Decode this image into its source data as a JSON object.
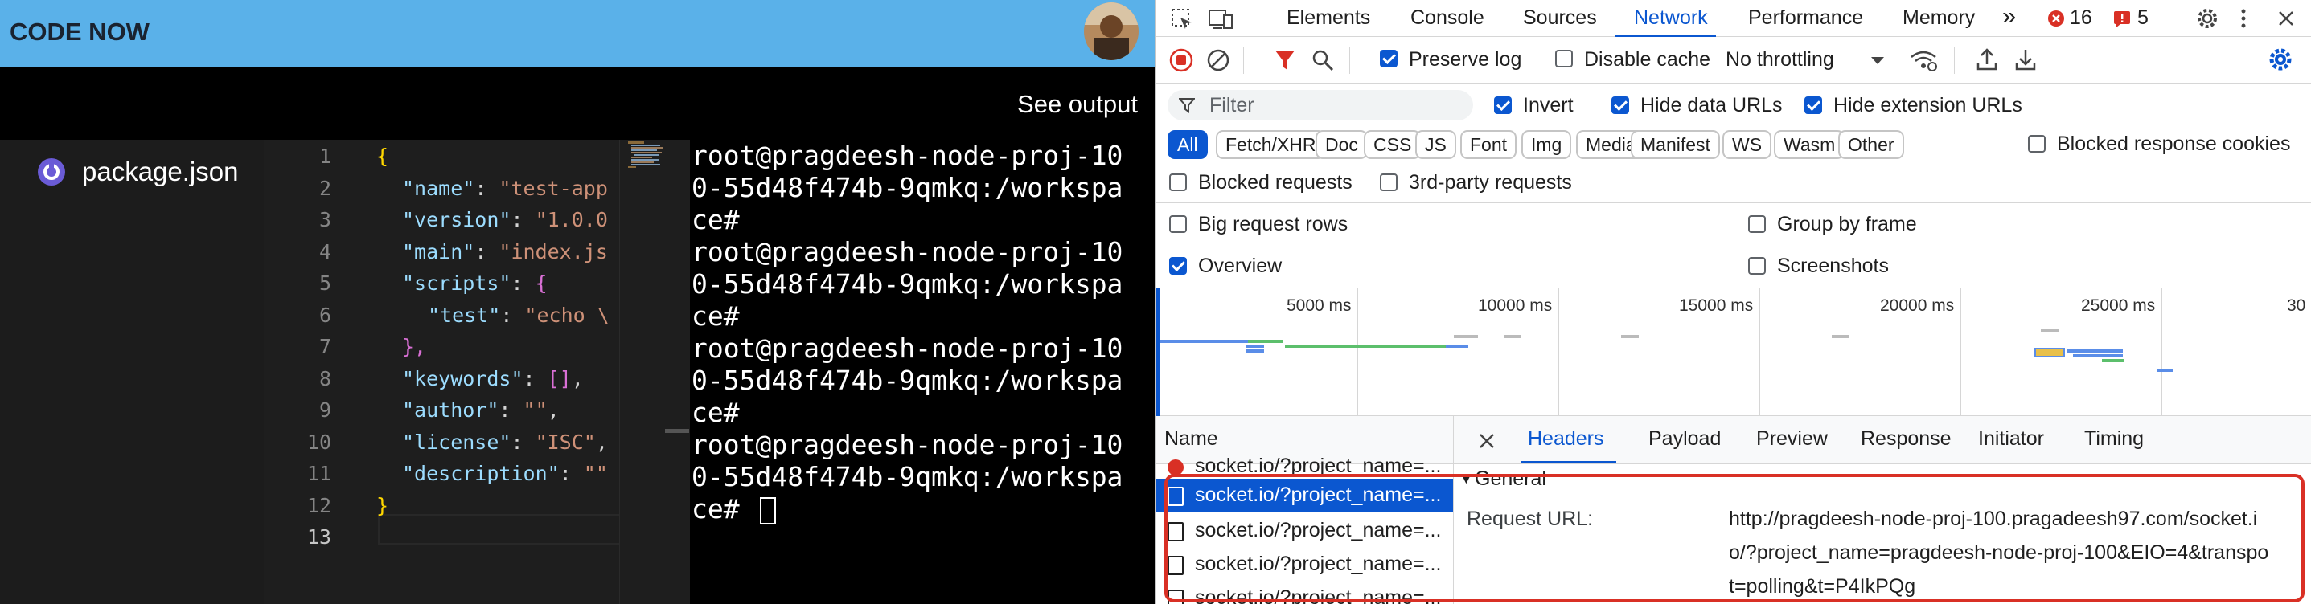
{
  "app": {
    "title": "CODE NOW",
    "see_output": "See output",
    "file_name": "package.json"
  },
  "editor": {
    "line_numbers": [
      "1",
      "2",
      "3",
      "4",
      "5",
      "6",
      "7",
      "8",
      "9",
      "10",
      "11",
      "12",
      "13"
    ],
    "lines": [
      [
        "{"
      ],
      [
        "\"name\"",
        ": ",
        "\"test-app"
      ],
      [
        "\"version\"",
        ": ",
        "\"1.0.0"
      ],
      [
        "\"main\"",
        ": ",
        "\"index.js"
      ],
      [
        "\"scripts\"",
        ": ",
        "{"
      ],
      [
        "\"test\"",
        ": ",
        "\"echo \\"
      ],
      [
        "},"
      ],
      [
        "\"keywords\"",
        ": ",
        "[]",
        ","
      ],
      [
        "\"author\"",
        ": ",
        "\"\"",
        ","
      ],
      [
        "\"license\"",
        ": ",
        "\"ISC\"",
        ","
      ],
      [
        "\"description\"",
        ": ",
        "\"\""
      ],
      [
        "}"
      ],
      [
        ""
      ]
    ]
  },
  "terminal": {
    "lines": [
      "root@pragdeesh-node-proj-10",
      "0-55d48f474b-9qmkq:/workspa",
      "ce#",
      "root@pragdeesh-node-proj-10",
      "0-55d48f474b-9qmkq:/workspa",
      "ce#",
      "root@pragdeesh-node-proj-10",
      "0-55d48f474b-9qmkq:/workspa",
      "ce#",
      "root@pragdeesh-node-proj-10",
      "0-55d48f474b-9qmkq:/workspa",
      "ce# "
    ]
  },
  "devtools": {
    "tabs": {
      "elements": "Elements",
      "console": "Console",
      "sources": "Sources",
      "network": "Network",
      "performance": "Performance",
      "memory": "Memory"
    },
    "more_tabs": "»",
    "errors_count": "16",
    "warnings_count": "5",
    "toolbar": {
      "preserve_log": "Preserve log",
      "disable_cache": "Disable cache",
      "throttling": "No throttling"
    },
    "filter": {
      "placeholder": "Filter",
      "invert": "Invert",
      "hide_data_urls": "Hide data URLs",
      "hide_extension_urls": "Hide extension URLs"
    },
    "types": [
      "All",
      "Fetch/XHR",
      "Doc",
      "CSS",
      "JS",
      "Font",
      "Img",
      "Media",
      "Manifest",
      "WS",
      "Wasm",
      "Other"
    ],
    "blocked_response_cookies": "Blocked response cookies",
    "blocked_requests": "Blocked requests",
    "third_party": "3rd-party requests",
    "big_request_rows": "Big request rows",
    "group_by_frame": "Group by frame",
    "overview_label": "Overview",
    "screenshots": "Screenshots",
    "overview_ticks": [
      "5000 ms",
      "10000 ms",
      "15000 ms",
      "20000 ms",
      "25000 ms",
      "30"
    ],
    "name_header": "Name",
    "requests": [
      "socket.io/?project_name=...",
      "socket.io/?project_name=...",
      "socket.io/?project_name=...",
      "socket.io/?project_name=...",
      "socket.io/?project_name=..."
    ],
    "detail_tabs": {
      "headers": "Headers",
      "payload": "Payload",
      "preview": "Preview",
      "response": "Response",
      "initiator": "Initiator",
      "timing": "Timing"
    },
    "general": {
      "title": "General",
      "request_url_label": "Request URL:",
      "request_url_lines": [
        "http://pragdeesh-node-proj-100.pragadeesh97.com/socket.i",
        "o/?project_name=pragdeesh-node-proj-100&EIO=4&transpo",
        "t=polling&t=P4IkPQg"
      ]
    }
  },
  "colors": {
    "topbar": "#5ab1e9",
    "accent_blue": "#0b57d0",
    "highlight_red": "#d93025"
  }
}
